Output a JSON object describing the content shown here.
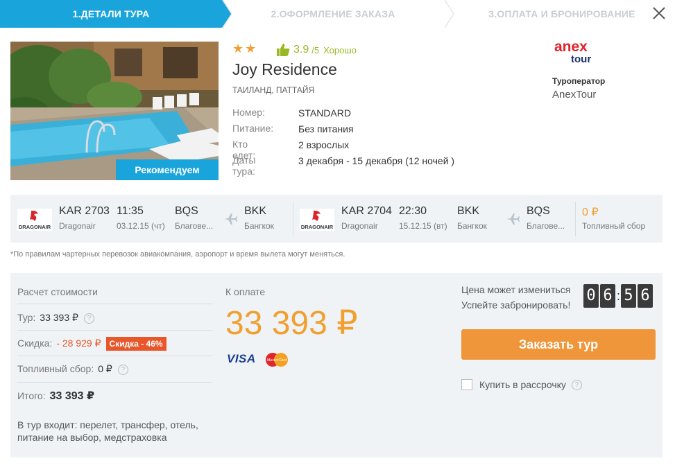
{
  "steps": [
    {
      "label": "1.Детали тура"
    },
    {
      "label": "2.Оформление заказа"
    },
    {
      "label": "3.Оплата и бронирование"
    }
  ],
  "colors": {
    "accent": "#1aa4dc",
    "orange": "#f0963a",
    "rating_green": "#9ab826",
    "discount_red": "#e8562a"
  },
  "hotel": {
    "stars": "★★",
    "rating_score": "3.9",
    "rating_outof": "/5",
    "rating_word": "Хорошо",
    "name": "Joy Residence",
    "location": "ТАИЛАНД, ПАТТАЙЯ",
    "recommend_badge": "Рекомендуем",
    "details": [
      {
        "label": "Номер:",
        "value": "STANDARD"
      },
      {
        "label": "Питание:",
        "value": "Без питания"
      },
      {
        "label": "Кто едет:",
        "value": "2 взрослых"
      },
      {
        "label": "Даты тура:",
        "value": "3 декабря - 15 декабря (12 ночей )"
      }
    ]
  },
  "operator": {
    "logo_top": "anex",
    "logo_bottom": "tour",
    "label": "Туроператор",
    "name": "AnexTour"
  },
  "flights": [
    {
      "airline_logo": "DRAGONAIR",
      "code": "KAR 2703",
      "airline": "Dragonair",
      "time": "11:35",
      "date": "03.12.15 (чт)",
      "from_code": "BQS",
      "from_city": "Благове...",
      "to_code": "BKK",
      "to_city": "Бангкок"
    },
    {
      "airline_logo": "DRAGONAIR",
      "code": "KAR 2704",
      "airline": "Dragonair",
      "time": "22:30",
      "date": "15.12.15 (вт)",
      "from_code": "BKK",
      "from_city": "Бангкок",
      "to_code": "BQS",
      "to_city": "Благове..."
    }
  ],
  "fuel": {
    "value": "0 ₽",
    "label": "Топливный сбор"
  },
  "note": "*По правилам чартерных перевозок авиакомпания, аэропорт и время вылета могут меняться.",
  "calc": {
    "title": "Расчет стоимости",
    "tour_label": "Тур:",
    "tour_value": "33 393 ₽",
    "discount_label": "Скидка:",
    "discount_value": "- 28 929 ₽",
    "discount_badge": "Скидка - 46%",
    "fuel_label": "Топливный сбор:",
    "fuel_value": "0 ₽",
    "total_label": "Итого:",
    "total_value": "33 393 ₽",
    "help": "?",
    "includes": "В тур входит: перелет, трансфер, отель, питание на выбор, медстраховка"
  },
  "payment": {
    "label": "К оплате",
    "amount": "33 393 ₽",
    "visa": "VISA",
    "mastercard": "MasterCard"
  },
  "booking": {
    "change_label": "Цена может измениться",
    "hurry_label": "Успейте забронировать!",
    "timer": [
      "0",
      "6",
      "5",
      "6"
    ],
    "order_button": "Заказать тур",
    "installment_label": "Купить в рассрочку"
  }
}
